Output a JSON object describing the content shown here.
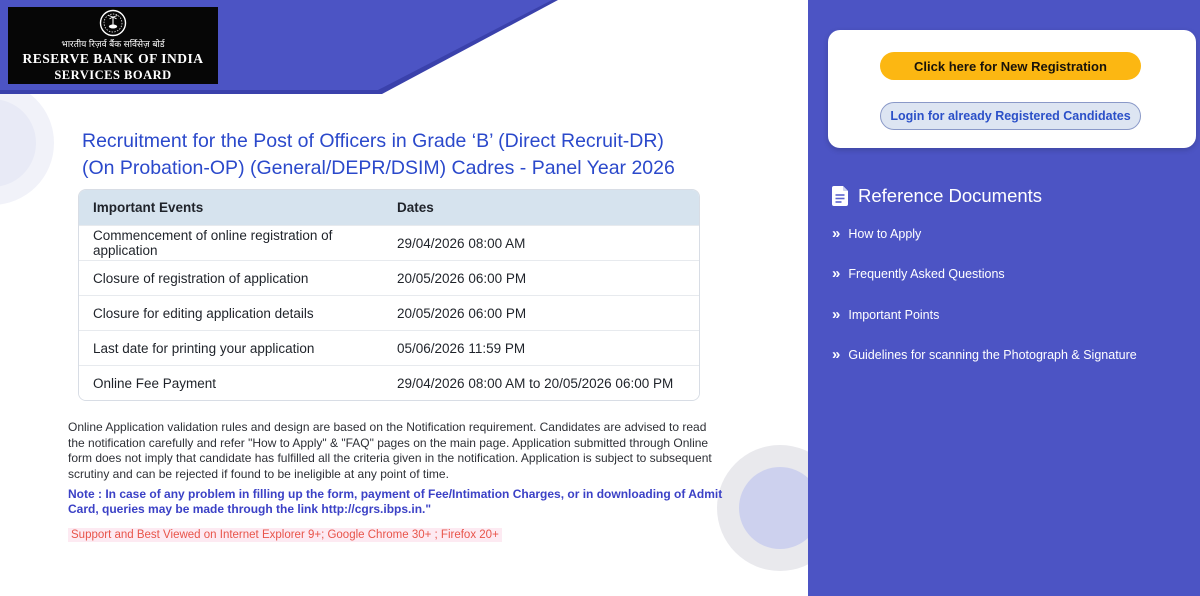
{
  "brand": {
    "hindi_line": "भारतीय रिज़र्व बैंक सर्विसेज़ बोर्ड",
    "name_line1": "RESERVE BANK OF INDIA",
    "name_line2": "SERVICES BOARD",
    "emblem_icon": "rbi-seal-icon"
  },
  "main": {
    "title": "Recruitment for the Post of Officers in Grade ‘B’ (Direct Recruit-DR) (On Probation-OP) (General/DEPR/DSIM) Cadres - Panel Year 2026",
    "table": {
      "headers": [
        "Important Events",
        "Dates"
      ],
      "rows": [
        [
          "Commencement of online registration of application",
          "29/04/2026 08:00 AM"
        ],
        [
          "Closure of registration of application",
          "20/05/2026 06:00 PM"
        ],
        [
          "Closure for editing application details",
          "20/05/2026 06:00 PM"
        ],
        [
          "Last date for printing your application",
          "05/06/2026 11:59 PM"
        ],
        [
          "Online Fee Payment",
          "29/04/2026 08:00 AM to 20/05/2026 06:00 PM"
        ]
      ]
    },
    "disclaimer": "Online Application validation rules and design are based on the Notification requirement. Candidates are advised to read the notification carefully and refer \"How to Apply\" & \"FAQ\" pages on the main page. Application submitted through Online form does not imply that candidate has fulfilled all the criteria given in the notification. Application is subject to subsequent scrutiny and can be rejected if found to be ineligible at any point of time.",
    "note": "Note : In case of any problem in filling up the form, payment of Fee/Intimation Charges, or in downloading of Admit Card, queries may be made through the link http://cgrs.ibps.in.\"",
    "support": "Support and Best Viewed on Internet Explorer 9+; Google Chrome 30+ ; Firefox 20+"
  },
  "sidebar": {
    "new_registration_label": "Click here for New Registration",
    "login_label": "Login for already Registered Candidates",
    "reference_heading": "Reference Documents",
    "reference_icon": "document-icon",
    "link_icon": "double-chevron-icon",
    "links": [
      {
        "label": "How to Apply"
      },
      {
        "label": "Frequently Asked Questions"
      },
      {
        "label": "Important Points"
      },
      {
        "label": "Guidelines for scanning the Photograph & Signature"
      }
    ]
  },
  "icons": {
    "double_chevron": "»"
  },
  "colors": {
    "panel_purple": "#4c54c4",
    "band_purple": "#4c54c4",
    "band_edge_dark": "#3a41ab",
    "title_blue": "#2b49cb",
    "note_blue": "#3b41c6",
    "support_red": "#e8544a",
    "support_bg_pink": "#fdeaf2",
    "table_header_bg": "#d6e3ee",
    "button_yellow": "#fcb712",
    "login_button_bg": "#dde5f2",
    "login_text_blue": "#2b50c8",
    "logo_bg_black": "#060606"
  }
}
